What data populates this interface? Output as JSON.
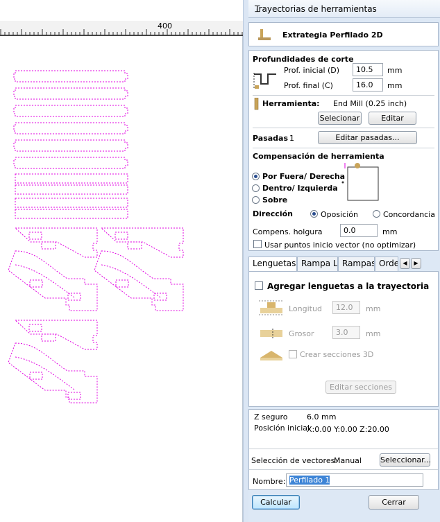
{
  "ruler": {
    "label": "400"
  },
  "panel": {
    "title": "Trayectorias de herramientas",
    "pin_icon": "pin-icon",
    "header": {
      "title": "Extrategia Perfilado 2D",
      "icon": "profile-tool-icon"
    },
    "depth": {
      "heading": "Profundidades de corte",
      "start_label": "Prof. inicial (D)",
      "start_value": "10.5",
      "start_unit": "mm",
      "end_label": "Prof. final (C)",
      "end_value": "16.0",
      "end_unit": "mm"
    },
    "tool": {
      "label": "Herramienta:",
      "name": "End Mill (0.25 inch)",
      "select_label": "Selecionar",
      "edit_label": "Editar"
    },
    "passes": {
      "label": "Pasadas",
      "count": "1",
      "edit_label": "Editar pasadas..."
    },
    "compensation": {
      "heading": "Compensación de herramienta",
      "options": [
        "Por Fuera/ Derecha",
        "Dentro/ Izquierda",
        "Sobre"
      ],
      "selected": 0
    },
    "direction": {
      "label": "Dirección",
      "options": [
        "Oposición",
        "Concordancia"
      ],
      "selected": 0
    },
    "allowance": {
      "label": "Compens. holgura",
      "value": "0.0",
      "unit": "mm"
    },
    "vector_start": {
      "label": "Usar puntos inicio vector (no optimizar)",
      "checked": false
    },
    "tabs": [
      "Lenguetas",
      "Rampa L.",
      "Rampas",
      "Orde"
    ],
    "active_tab": 0,
    "lenguetas": {
      "add_label": "Agregar lenguetas a la trayectoria",
      "length_label": "Longitud",
      "length_value": "12.0",
      "length_unit": "mm",
      "thickness_label": "Grosor",
      "thickness_value": "3.0",
      "thickness_unit": "mm",
      "sections_label": "Crear secciones 3D",
      "edit_sections_label": "Editar secciones"
    },
    "info": {
      "safe_z_label": "Z seguro",
      "safe_z_value": "6.0 mm",
      "home_label": "Posición inicial",
      "home_value": "X:0.00 Y:0.00 Z:20.00"
    },
    "vectors": {
      "label": "Selección de vectores:",
      "mode": "Manual",
      "select_label": "Seleccionar..."
    },
    "name": {
      "label": "Nombre:",
      "value": "Perfilado 1"
    },
    "calculate_label": "Calcular",
    "close_label": "Cerrar"
  },
  "colors": {
    "vector_magenta": "#e100e1",
    "panel_bg": "#dde8f5"
  }
}
